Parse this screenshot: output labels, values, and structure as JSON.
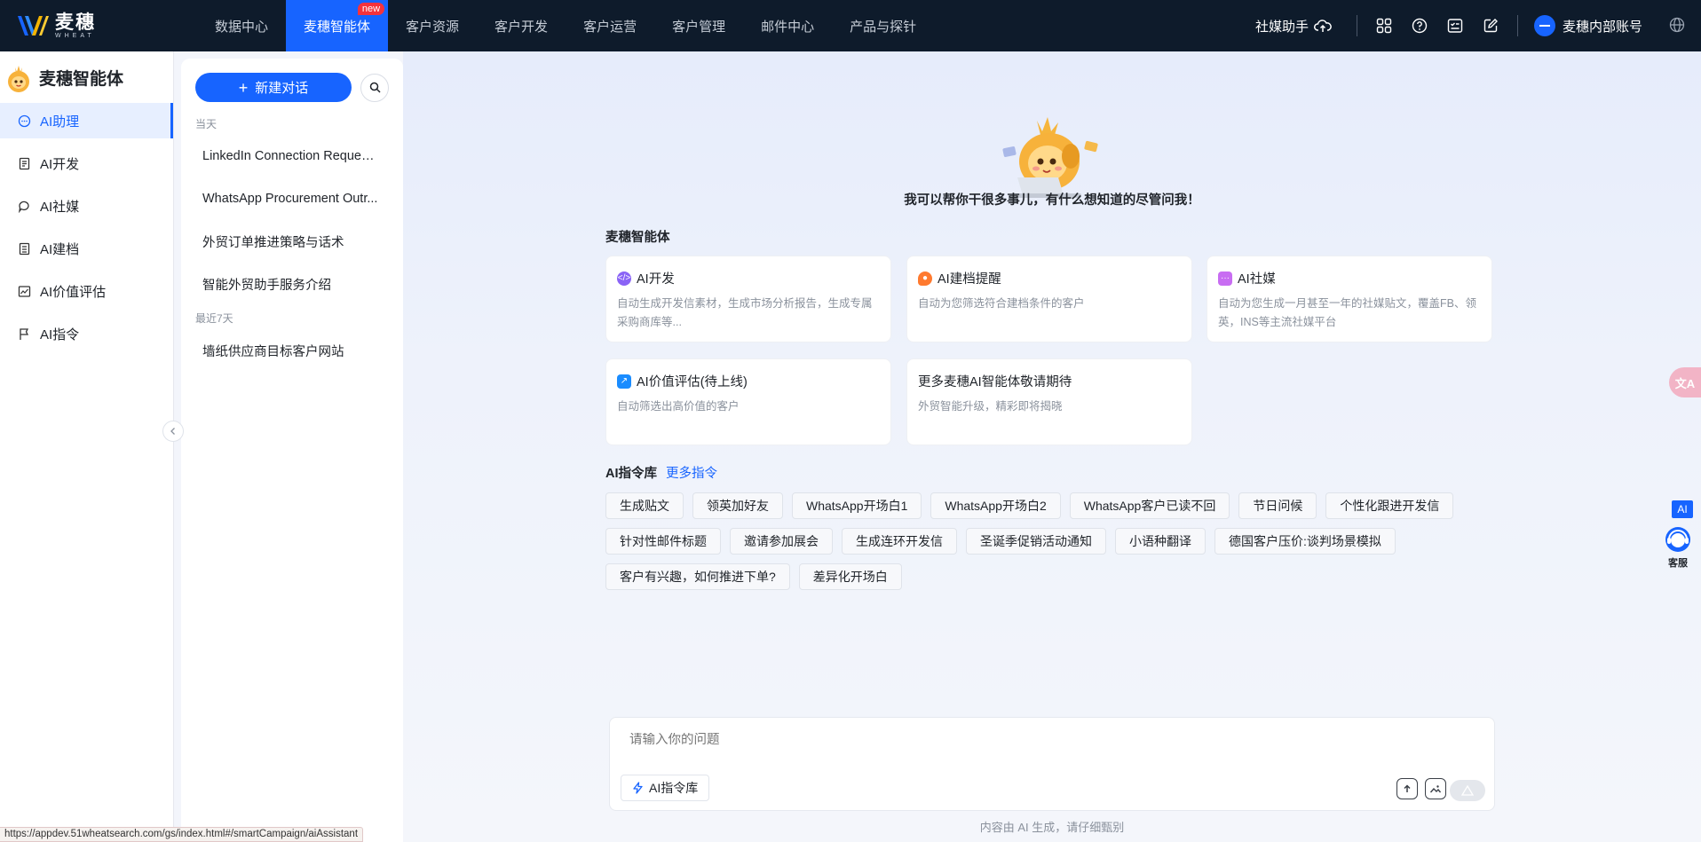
{
  "brand": {
    "logo_cn": "麦穗",
    "logo_en": "WHEAT"
  },
  "nav": {
    "items": [
      {
        "label": "数据中心"
      },
      {
        "label": "麦穗智能体",
        "badge": "new"
      },
      {
        "label": "客户资源"
      },
      {
        "label": "客户开发"
      },
      {
        "label": "客户运营"
      },
      {
        "label": "客户管理"
      },
      {
        "label": "邮件中心"
      },
      {
        "label": "产品与探针"
      }
    ],
    "active_index": 1
  },
  "topright": {
    "social_helper": "社媒助手",
    "account": "麦穗内部账号",
    "icons": [
      "cloud-upload-icon",
      "apps-grid-icon",
      "help-icon",
      "checklist-icon",
      "edit-icon",
      "globe-icon"
    ]
  },
  "sidebar": {
    "title": "麦穗智能体",
    "items": [
      {
        "label": "AI助理",
        "icon": "chat-icon"
      },
      {
        "label": "AI开发",
        "icon": "document-icon"
      },
      {
        "label": "AI社媒",
        "icon": "social-chat-icon"
      },
      {
        "label": "AI建档",
        "icon": "file-list-icon"
      },
      {
        "label": "AI价值评估",
        "icon": "trend-chart-icon"
      },
      {
        "label": "AI指令",
        "icon": "flag-icon"
      }
    ],
    "active_index": 0
  },
  "conversations": {
    "new_chat": "新建对话",
    "groups": [
      {
        "label": "当天",
        "items": [
          "LinkedIn Connection Request...",
          "WhatsApp Procurement Outr...",
          "外贸订单推进策略与话术",
          "智能外贸助手服务介绍"
        ]
      },
      {
        "label": "最近7天",
        "items": [
          "墙纸供应商目标客户网站"
        ]
      }
    ]
  },
  "main": {
    "greeting": "我可以帮你干很多事儿，有什么想知道的尽管问我！",
    "agents_title": "麦穗智能体",
    "agents": [
      {
        "title": "AI开发",
        "desc": "自动生成开发信素材，生成市场分析报告，生成专属采购商库等...",
        "color": "#8a63f6"
      },
      {
        "title": "AI建档提醒",
        "desc": "自动为您筛选符合建档条件的客户",
        "color": "#ff7a2f"
      },
      {
        "title": "AI社媒",
        "desc": "自动为您生成一月甚至一年的社媒贴文，覆盖FB、领英，INS等主流社媒平台",
        "color": "#c86df2"
      },
      {
        "title": "AI价值评估(待上线)",
        "desc": "自动筛选出高价值的客户",
        "color": "#1a8cff"
      },
      {
        "title": "更多麦穗AI智能体敬请期待",
        "desc": "外贸智能升级，精彩即将揭晓",
        "color": ""
      }
    ],
    "commands_title": "AI指令库",
    "commands_more": "更多指令",
    "commands": [
      [
        "生成贴文",
        "领英加好友",
        "WhatsApp开场白1",
        "WhatsApp开场白2",
        "WhatsApp客户已读不回",
        "节日问候",
        "个性化跟进开发信"
      ],
      [
        "针对性邮件标题",
        "邀请参加展会",
        "生成连环开发信",
        "圣诞季促销活动通知",
        "小语种翻译",
        "德国客户压价:谈判场景模拟"
      ],
      [
        "客户有兴趣，如何推进下单?",
        "差异化开场白"
      ]
    ],
    "input_placeholder": "请输入你的问题",
    "cmdlib_button": "AI指令库",
    "disclaimer": "内容由 AI 生成，请仔细甄别"
  },
  "floating": {
    "translate_icon": "translate-icon",
    "ai_badge": "AI",
    "service_label": "客服"
  },
  "statusbar": {
    "url": "https://appdev.51wheatsearch.com/gs/index.html#/smartCampaign/aiAssistant"
  },
  "colors": {
    "accent": "#1764ff",
    "topbar": "#0e1b2b",
    "badge": "#f5323c"
  }
}
